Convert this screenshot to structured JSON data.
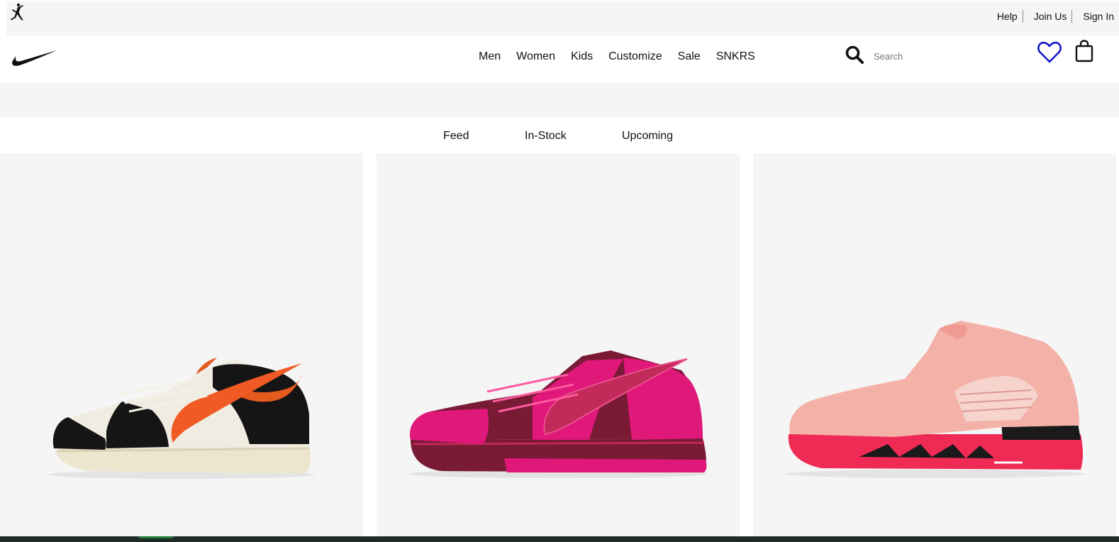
{
  "utility": {
    "links": [
      "Help",
      "Join Us",
      "Sign In"
    ]
  },
  "header": {
    "nav": [
      "Men",
      "Women",
      "Kids",
      "Customize",
      "Sale",
      "SNKRS"
    ],
    "search_placeholder": "Search"
  },
  "tabs": [
    "Feed",
    "In-Stock",
    "Upcoming"
  ],
  "icons": {
    "brand_secondary": "jordan-jumpman-icon",
    "brand_primary": "nike-swoosh-icon",
    "search": "search-icon",
    "favorites": "heart-icon",
    "bag": "bag-icon"
  },
  "colors": {
    "favorites_accent": "#1515c9",
    "panel_gray": "#f5f5f5",
    "footer_strip": "#1e2b24"
  },
  "products": [
    {
      "icon": "sneaker-black-white-orange-icon",
      "colors": [
        "#111111",
        "#f0ece2",
        "#f05a24"
      ]
    },
    {
      "icon": "sneaker-pink-burgundy-icon",
      "colors": [
        "#e0187a",
        "#7a1b36",
        "#c22a5a"
      ]
    },
    {
      "icon": "sneaker-light-pink-red-icon",
      "colors": [
        "#f4b1a7",
        "#ef2a55",
        "#1a1a1a"
      ]
    }
  ]
}
